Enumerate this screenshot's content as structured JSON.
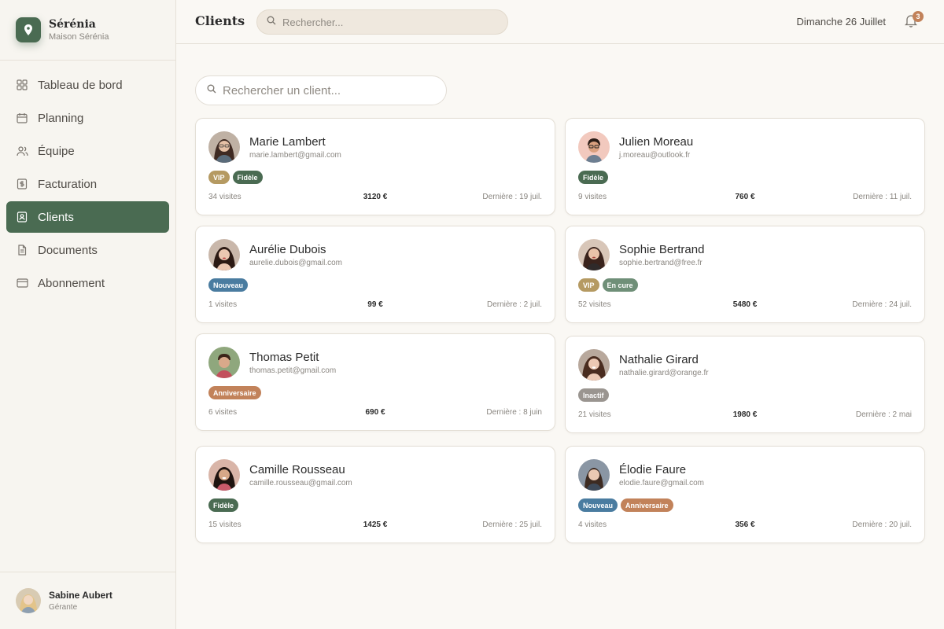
{
  "brand": {
    "name": "Sérénia",
    "subtitle": "Maison Sérénia"
  },
  "nav": [
    {
      "label": "Tableau de bord",
      "icon": "grid-icon"
    },
    {
      "label": "Planning",
      "icon": "calendar-icon"
    },
    {
      "label": "Équipe",
      "icon": "users-icon"
    },
    {
      "label": "Facturation",
      "icon": "dollar-icon"
    },
    {
      "label": "Clients",
      "icon": "contact-icon",
      "active": true
    },
    {
      "label": "Documents",
      "icon": "file-icon"
    },
    {
      "label": "Abonnement",
      "icon": "card-icon"
    }
  ],
  "user": {
    "name": "Sabine Aubert",
    "role": "Gérante"
  },
  "header": {
    "title": "Clients",
    "search_placeholder": "Rechercher...",
    "date": "Dimanche 26 Juillet",
    "notifications": "3"
  },
  "client_search_placeholder": "Rechercher un client...",
  "colors": {
    "accent": "#4a6b52",
    "tag_vip": "#b59a62",
    "tag_fidele": "#4a6b52",
    "tag_nouveau": "#4a7ca0",
    "tag_en_cure": "#6f8f78",
    "tag_anniversaire": "#c2825a",
    "tag_inactif": "#9a9590"
  },
  "clients": [
    {
      "name": "Marie Lambert",
      "email": "marie.lambert@gmail.com",
      "tags": [
        "VIP",
        "Fidèle"
      ],
      "visits": "34 visites",
      "amount": "3120 €",
      "last": "Dernière : 19 juil."
    },
    {
      "name": "Julien Moreau",
      "email": "j.moreau@outlook.fr",
      "tags": [
        "Fidèle"
      ],
      "visits": "9 visites",
      "amount": "760 €",
      "last": "Dernière : 11 juil."
    },
    {
      "name": "Aurélie Dubois",
      "email": "aurelie.dubois@gmail.com",
      "tags": [
        "Nouveau"
      ],
      "visits": "1 visites",
      "amount": "99 €",
      "last": "Dernière : 2 juil."
    },
    {
      "name": "Sophie Bertrand",
      "email": "sophie.bertrand@free.fr",
      "tags": [
        "VIP",
        "En cure"
      ],
      "visits": "52 visites",
      "amount": "5480 €",
      "last": "Dernière : 24 juil."
    },
    {
      "name": "Thomas Petit",
      "email": "thomas.petit@gmail.com",
      "tags": [
        "Anniversaire"
      ],
      "visits": "6 visites",
      "amount": "690 €",
      "last": "Dernière : 8 juin"
    },
    {
      "name": "Nathalie Girard",
      "email": "nathalie.girard@orange.fr",
      "tags": [
        "Inactif"
      ],
      "visits": "21 visites",
      "amount": "1980 €",
      "last": "Dernière : 2 mai"
    },
    {
      "name": "Camille Rousseau",
      "email": "camille.rousseau@gmail.com",
      "tags": [
        "Fidèle"
      ],
      "visits": "15 visites",
      "amount": "1425 €",
      "last": "Dernière : 25 juil."
    },
    {
      "name": "Élodie Faure",
      "email": "elodie.faure@gmail.com",
      "tags": [
        "Nouveau",
        "Anniversaire"
      ],
      "visits": "4 visites",
      "amount": "356 €",
      "last": "Dernière : 20 juil."
    }
  ]
}
